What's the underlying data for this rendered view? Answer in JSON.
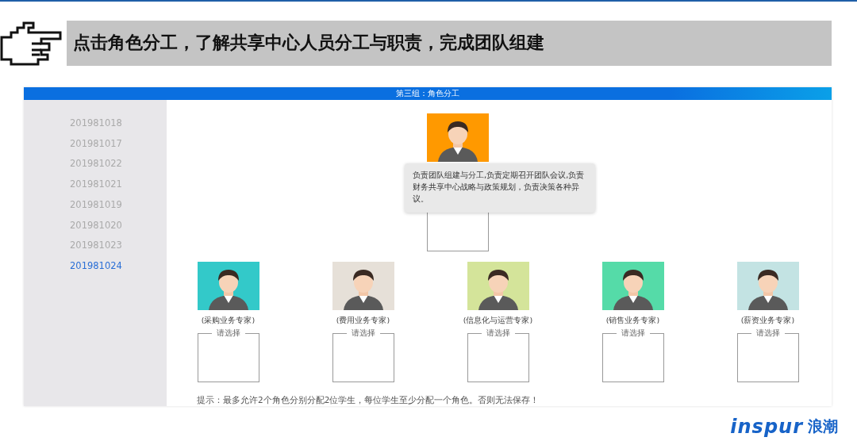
{
  "banner": {
    "title": "点击角色分工，了解共享中心人员分工与职责，完成团队组建"
  },
  "app": {
    "title": "第三组：角色分工",
    "students": [
      {
        "label": "201981018",
        "selected": false
      },
      {
        "label": "201981017",
        "selected": false
      },
      {
        "label": "201981022",
        "selected": false
      },
      {
        "label": "201981021",
        "selected": false
      },
      {
        "label": "201981019",
        "selected": false
      },
      {
        "label": "201981020",
        "selected": false
      },
      {
        "label": "201981023",
        "selected": false
      },
      {
        "label": "201981024",
        "selected": true
      }
    ],
    "leader": {
      "color": "#ff9900",
      "tooltip": "负责团队组建与分工,负责定期召开团队会议,负责财务共享中心战略与政策规划，负责决策各种异议。"
    },
    "roles": [
      {
        "label": "(采购业务专家)",
        "color": "#33c9c9",
        "placeholder": "请选择"
      },
      {
        "label": "(费用业务专家)",
        "color": "#e6e0d8",
        "placeholder": "请选择"
      },
      {
        "label": "(信息化与运营专家)",
        "color": "#d4e49a",
        "placeholder": "请选择"
      },
      {
        "label": "(销售业务专家)",
        "color": "#55dba8",
        "placeholder": "请选择"
      },
      {
        "label": "(薪资业务专家)",
        "color": "#c3e3e3",
        "placeholder": "请选择"
      }
    ],
    "hint": "提示：最多允许2个角色分别分配2位学生，每位学生至少分配一个角色。否则无法保存！"
  },
  "logo": {
    "brand": "inspur",
    "name": "浪潮"
  }
}
